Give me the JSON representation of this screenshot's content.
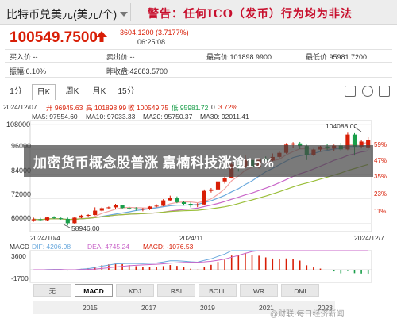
{
  "header": {
    "pair_title": "比特币兑美元(美元/个)",
    "warning": "警告：任何ICO（发币）行为均为非法"
  },
  "quote": {
    "price": "100549.7500",
    "change": "3604.1200 (3.7177%)",
    "time": "06:25:08"
  },
  "info": {
    "buy_label": "买入价:--",
    "sell_label": "卖出价:--",
    "high_label": "最高价:101898.9900",
    "low_label": "最低价:95981.7200",
    "amplitude_label": "振幅:6.10%",
    "prev_close_label": "昨收盘:42683.5700"
  },
  "period_tabs": [
    {
      "label": "1分",
      "active": false
    },
    {
      "label": "日K",
      "active": true
    },
    {
      "label": "周K",
      "active": false
    },
    {
      "label": "月K",
      "active": false
    },
    {
      "label": "15分",
      "active": false
    }
  ],
  "ohlc_line": {
    "date": "2024/12/07",
    "open": "开 96945.63",
    "high": "高 101898.99",
    "close": "收 100549.75",
    "low": "低 95981.72",
    "volume": "0",
    "pct": "3.72%"
  },
  "ma_legend": [
    {
      "label": "MA5: 97554.60",
      "color": "#f3a3a3"
    },
    {
      "label": "MA10: 97033.33",
      "color": "#6aa9dd"
    },
    {
      "label": "MA20: 95750.37",
      "color": "#c966c9"
    },
    {
      "label": "MA30: 92011.41",
      "color": "#9bbf3a"
    }
  ],
  "y_axis": [
    "108000",
    "96000",
    "84000",
    "72000",
    "60000"
  ],
  "pct_axis": [
    "59%",
    "47%",
    "35%",
    "23%",
    "11%"
  ],
  "annotations": {
    "max_label": "104088.00",
    "min_label": "58946.00"
  },
  "x_dates": [
    "2024/10/4",
    "2024/11",
    "2024/12/7"
  ],
  "macd": {
    "title": "MACD",
    "dif": "DIF: 4206.98",
    "dea": "DEA: 4745.24",
    "macd": "MACD: -1076.53",
    "y_labels": [
      "3600",
      "-1700"
    ]
  },
  "indicator_tabs": [
    {
      "label": "无",
      "active": false
    },
    {
      "label": "MACD",
      "active": true
    },
    {
      "label": "KDJ",
      "active": false
    },
    {
      "label": "RSI",
      "active": false
    },
    {
      "label": "BOLL",
      "active": false
    },
    {
      "label": "WR",
      "active": false
    },
    {
      "label": "DMI",
      "active": false
    }
  ],
  "timeline_years": [
    "2015",
    "2017",
    "2019",
    "2021",
    "2023"
  ],
  "overlay_caption": "加密货币概念股普涨 嘉楠科技涨逾15%",
  "watermark": "@财联·每日经济新闻",
  "colors": {
    "up": "#d81e06",
    "down": "#1a9e4a",
    "accent": "#d81e06"
  },
  "chart_data": {
    "type": "candlestick",
    "title": "",
    "y_range": [
      56000,
      110000
    ],
    "x_start": "2024/10/4",
    "x_end": "2024/12/7",
    "candles": [
      [
        61500,
        62800,
        60800,
        62000
      ],
      [
        62000,
        62700,
        61200,
        61600
      ],
      [
        61600,
        63200,
        61400,
        62900
      ],
      [
        62900,
        63500,
        62200,
        62500
      ],
      [
        62500,
        62900,
        61800,
        62200
      ],
      [
        62200,
        62800,
        58946,
        60100
      ],
      [
        60100,
        63000,
        59800,
        62800
      ],
      [
        62800,
        64200,
        62500,
        63800
      ],
      [
        63800,
        64500,
        63200,
        64100
      ],
      [
        64100,
        67800,
        63900,
        66200
      ],
      [
        66200,
        67900,
        65800,
        67400
      ],
      [
        67400,
        68200,
        66900,
        67800
      ],
      [
        67800,
        69500,
        67200,
        68900
      ],
      [
        68900,
        69100,
        67000,
        67500
      ],
      [
        67500,
        68100,
        66600,
        67300
      ],
      [
        67300,
        67900,
        66200,
        66800
      ],
      [
        66800,
        67500,
        65900,
        67100
      ],
      [
        67100,
        68400,
        66500,
        68200
      ],
      [
        68200,
        69300,
        67800,
        68600
      ],
      [
        68600,
        71800,
        68300,
        71200
      ],
      [
        71200,
        73500,
        70800,
        72500
      ],
      [
        72500,
        73100,
        69800,
        70300
      ],
      [
        70300,
        70900,
        68700,
        69500
      ],
      [
        69500,
        70200,
        67800,
        68700
      ],
      [
        68700,
        69800,
        67900,
        69200
      ],
      [
        69200,
        76500,
        69000,
        75800
      ],
      [
        75800,
        77200,
        75000,
        76500
      ],
      [
        76500,
        81500,
        76200,
        80400
      ],
      [
        80400,
        82800,
        79300,
        82100
      ],
      [
        82100,
        89900,
        81800,
        88700
      ],
      [
        88700,
        90300,
        85200,
        87400
      ],
      [
        87400,
        93000,
        86900,
        90800
      ],
      [
        90800,
        91200,
        86800,
        87400
      ],
      [
        87400,
        91800,
        86700,
        91200
      ],
      [
        91200,
        92500,
        89800,
        90600
      ],
      [
        90600,
        94000,
        90200,
        92300
      ],
      [
        92300,
        94900,
        91700,
        94300
      ],
      [
        94300,
        99000,
        93900,
        98300
      ],
      [
        98300,
        99500,
        96800,
        98900
      ],
      [
        98900,
        99600,
        96200,
        97600
      ],
      [
        97600,
        98200,
        90800,
        93100
      ],
      [
        93100,
        96300,
        92800,
        95900
      ],
      [
        95900,
        97700,
        94800,
        97400
      ],
      [
        97400,
        98600,
        95700,
        96400
      ],
      [
        96400,
        98300,
        95100,
        97800
      ],
      [
        97800,
        99200,
        95300,
        96000
      ],
      [
        96000,
        104088,
        95600,
        103200
      ],
      [
        103200,
        103900,
        93000,
        97300
      ],
      [
        97300,
        100500,
        96400,
        99800
      ],
      [
        96946,
        101899,
        95982,
        100550
      ]
    ],
    "ma": [
      {
        "name": "MA5",
        "color": "#f3a3a3",
        "values_from": "close",
        "period": 5
      },
      {
        "name": "MA10",
        "color": "#6aa9dd",
        "values_from": "close",
        "period": 10
      },
      {
        "name": "MA20",
        "color": "#c966c9",
        "values_from": "close",
        "period": 20
      },
      {
        "name": "MA30",
        "color": "#9bbf3a",
        "values_from": "close",
        "period": 30
      }
    ],
    "macd_range": [
      -3000,
      4500
    ]
  }
}
